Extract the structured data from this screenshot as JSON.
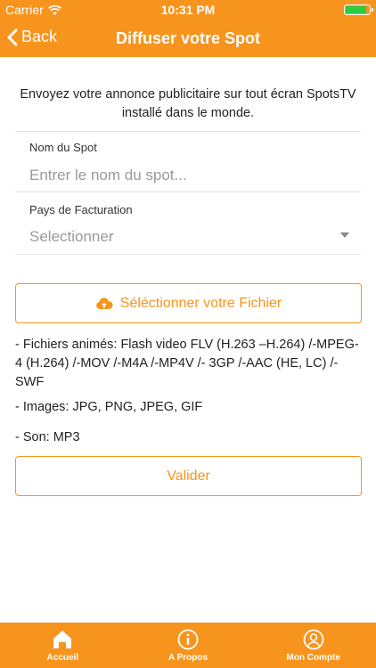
{
  "status_bar": {
    "carrier": "Carrier",
    "time": "10:31 PM"
  },
  "nav": {
    "back_label": "Back",
    "title": "Diffuser votre Spot"
  },
  "intro_text": "Envoyez votre annonce publicitaire sur tout écran SpotsTV installé dans le monde.",
  "form": {
    "spot_name_label": "Nom du Spot",
    "spot_name_placeholder": "Entrer le nom du spot...",
    "spot_name_value": "",
    "country_label": "Pays de Facturation",
    "country_value": "Selectionner"
  },
  "file_button_label": "Séléctionner votre Fichier",
  "info": {
    "animated": "- Fichiers animés: Flash video FLV (H.263 –H.264) /-MPEG-4 (H.264) /-MOV /-M4A /-MP4V /- 3GP /-AAC (HE, LC) /-SWF",
    "images": "- Images: JPG, PNG, JPEG, GIF",
    "sound": "- Son: MP3"
  },
  "submit_label": "Valider",
  "tabs": [
    {
      "label": "Accueil",
      "icon": "home-icon"
    },
    {
      "label": "A Propos",
      "icon": "info-icon"
    },
    {
      "label": "Mon Compte",
      "icon": "user-icon"
    }
  ],
  "colors": {
    "accent": "#f7941d",
    "battery": "#2ecc40"
  }
}
